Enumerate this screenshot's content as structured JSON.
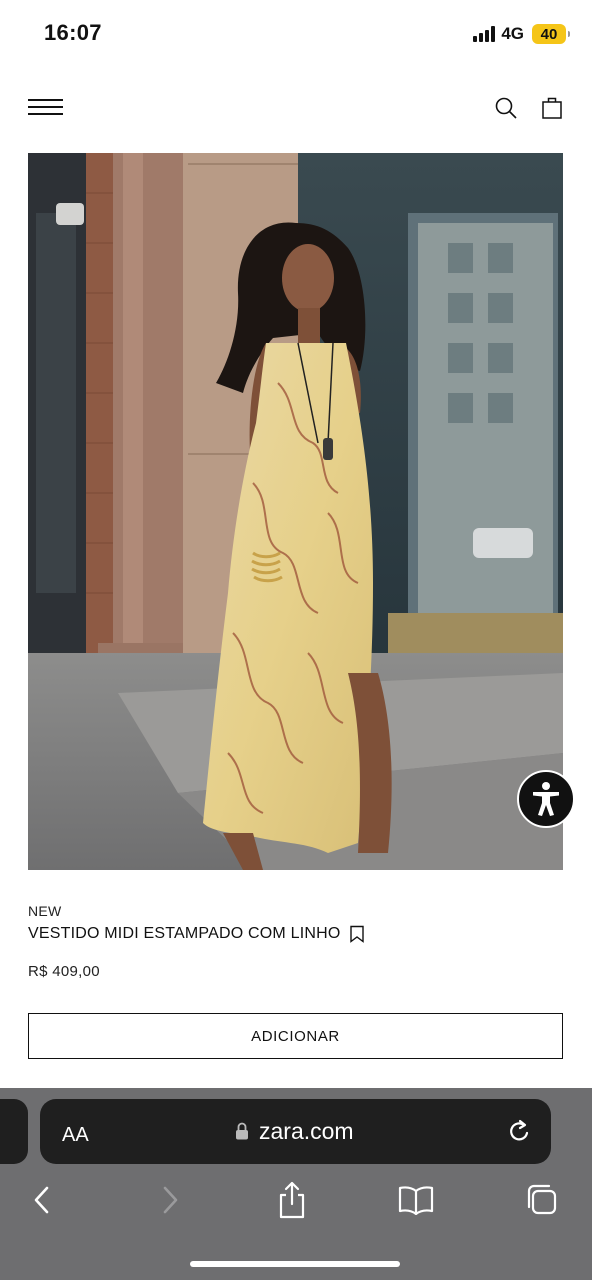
{
  "status_bar": {
    "time": "16:07",
    "network": "4G",
    "battery": "40",
    "battery_color": "#f5c518"
  },
  "header": {
    "menu_icon": "hamburger-menu-icon",
    "search_icon": "search-icon",
    "bag_icon": "shopping-bag-icon"
  },
  "product": {
    "tag": "NEW",
    "name": "VESTIDO MIDI ESTAMPADO COM LINHO",
    "price": "R$ 409,00",
    "add_label": "ADICIONAR",
    "image": "model-wearing-yellow-paisley-slip-dress"
  },
  "accessibility": {
    "icon": "accessibility-person-icon"
  },
  "browser": {
    "text_size_label": "AA",
    "url": "zara.com",
    "theme_color": "#6e6e70",
    "icons": [
      "back-icon",
      "forward-icon",
      "share-icon",
      "bookmarks-icon",
      "tabs-icon"
    ]
  }
}
